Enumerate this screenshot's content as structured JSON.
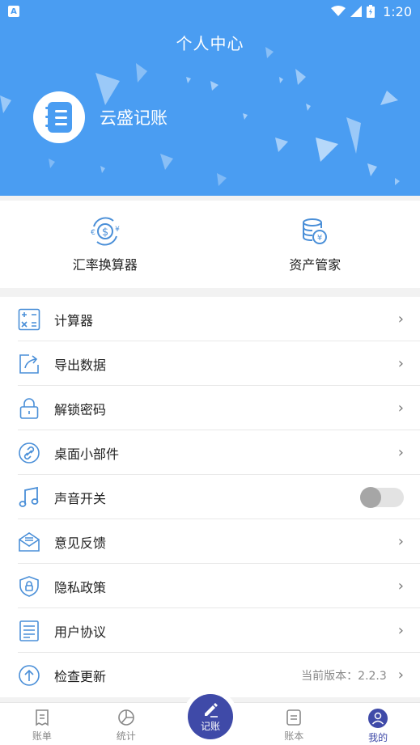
{
  "status_bar": {
    "time": "1:20",
    "app_icon": "A"
  },
  "header": {
    "title": "个人中心",
    "username": "云盛记账"
  },
  "tools": [
    {
      "label": "汇率换算器",
      "icon": "currency-exchange-icon"
    },
    {
      "label": "资产管家",
      "icon": "coin-stack-icon"
    }
  ],
  "menu": [
    {
      "label": "计算器",
      "icon": "calculator-icon"
    },
    {
      "label": "导出数据",
      "icon": "export-icon"
    },
    {
      "label": "解锁密码",
      "icon": "lock-icon"
    },
    {
      "label": "桌面小部件",
      "icon": "widget-link-icon"
    },
    {
      "label": "声音开关",
      "icon": "music-note-icon",
      "toggle_on": false
    },
    {
      "label": "意见反馈",
      "icon": "feedback-mail-icon"
    },
    {
      "label": "隐私政策",
      "icon": "privacy-shield-icon"
    },
    {
      "label": "用户协议",
      "icon": "agreement-doc-icon"
    },
    {
      "label": "检查更新",
      "icon": "update-arrow-icon",
      "version": "当前版本：2.2.3"
    }
  ],
  "chevron": "›",
  "nav": {
    "items": [
      "账单",
      "统计",
      "记账",
      "账本",
      "我的"
    ],
    "active": "我的"
  },
  "colors": {
    "primary": "#4a9df2",
    "accent": "#3f4aa8",
    "icon_blue": "#4a8fd8"
  }
}
